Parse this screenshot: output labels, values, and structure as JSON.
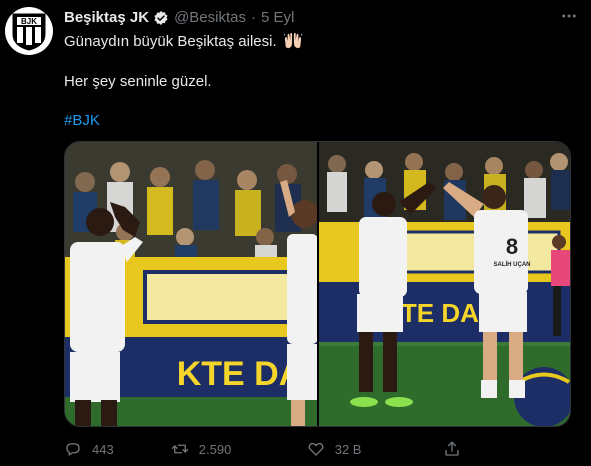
{
  "tweet": {
    "author_name": "Beşiktaş JK",
    "handle": "@Besiktas",
    "separator": "·",
    "time": "5 Eyl",
    "line1": "Günaydın büyük Beşiktaş ailesi.",
    "line2": "Her şey seninle güzel.",
    "hashtag": "#BJK",
    "avatar_text": "BJK",
    "avatar_year": "1903"
  },
  "media": {
    "left_banner_text": "KTE DA",
    "right_banner_text": "LİKTE DA",
    "player_number": "8",
    "player_name": "SALİH UÇAN"
  },
  "actions": {
    "reply_count": "443",
    "retweet_count": "2.590",
    "like_count": "32 B"
  },
  "colors": {
    "background": "#000000",
    "text": "#e7e9ea",
    "muted": "#71767b",
    "link": "#1d9bf0",
    "verified": "#e7e9ea"
  }
}
